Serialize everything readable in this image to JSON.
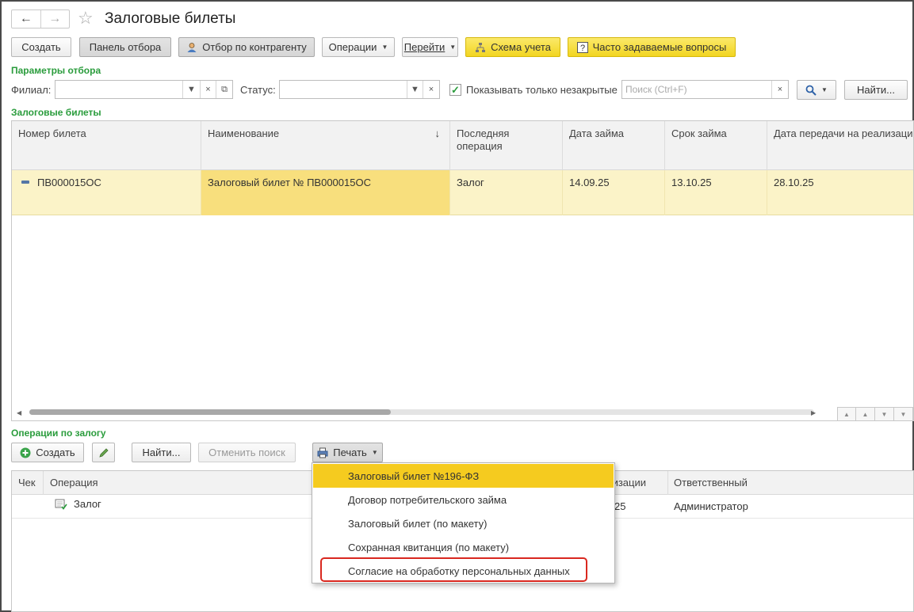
{
  "header": {
    "title": "Залоговые билеты"
  },
  "toolbar": {
    "create": "Создать",
    "filter_panel": "Панель отбора",
    "by_counterparty": "Отбор по контрагенту",
    "operations": "Операции",
    "goto": "Перейти",
    "scheme": "Схема учета",
    "faq": "Часто задаваемые вопросы"
  },
  "filter": {
    "section_title": "Параметры отбора",
    "branch_label": "Филиал:",
    "status_label": "Статус:",
    "only_open_label": "Показывать только незакрытые",
    "only_open_checked": true,
    "search_placeholder": "Поиск (Ctrl+F)",
    "find": "Найти..."
  },
  "tickets": {
    "section_title": "Залоговые билеты",
    "columns": [
      "Номер билета",
      "Наименование",
      "Последняя операция",
      "Дата займа",
      "Срок займа",
      "Дата передачи на реализацию"
    ],
    "sort_indicator": "↓",
    "rows": [
      {
        "number": "ПВ000015ОС",
        "name": "Залоговый билет № ПВ000015ОС",
        "last_op": "Залог",
        "loan_date": "14.09.25",
        "term": "13.10.25",
        "transfer_date": "28.10.25"
      }
    ]
  },
  "operations": {
    "section_title": "Операции по залогу",
    "create": "Создать",
    "find": "Найти...",
    "cancel_search": "Отменить поиск",
    "print": "Печать",
    "columns": [
      "Чек",
      "Операция",
      "лизации",
      "Ответственный"
    ],
    "rows": [
      {
        "check": "",
        "operation": "Залог",
        "realization": "25",
        "responsible": "Администратор"
      }
    ]
  },
  "print_menu": {
    "items": [
      "Залоговый билет №196-ФЗ",
      "Договор потребительского займа",
      "Залоговый билет (по макету)",
      "Сохранная квитанция (по макету)",
      "Согласие на обработку персональных данных"
    ],
    "active_index": 0,
    "highlighted_index": 4
  },
  "colors": {
    "section": "#2a9c3c",
    "row_highlight": "#fbf3c8",
    "menu_active": "#f5cb1f",
    "annotation": "#d9281f"
  }
}
